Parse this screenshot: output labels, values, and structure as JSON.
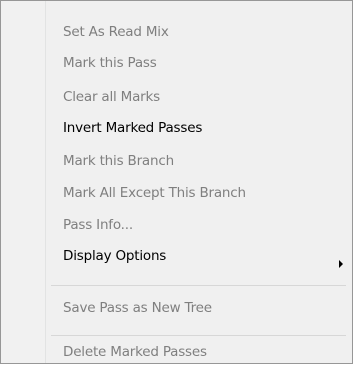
{
  "menu": {
    "items": [
      {
        "label": "Set As Read Mix",
        "enabled": false
      },
      {
        "label": "Mark this Pass",
        "enabled": false
      },
      {
        "label": "Clear all Marks",
        "enabled": false
      },
      {
        "label": "Invert Marked Passes",
        "enabled": true
      },
      {
        "label": "Mark this Branch",
        "enabled": false
      },
      {
        "label": "Mark All Except This Branch",
        "enabled": false
      },
      {
        "label": "Pass Info...",
        "enabled": false
      },
      {
        "label": "Display Options",
        "enabled": true,
        "submenu": true
      },
      {
        "label": "Save Pass as New Tree",
        "enabled": false
      },
      {
        "label": "Delete Marked Passes",
        "enabled": false
      }
    ],
    "submenu_icon": "chevron-right-icon"
  }
}
